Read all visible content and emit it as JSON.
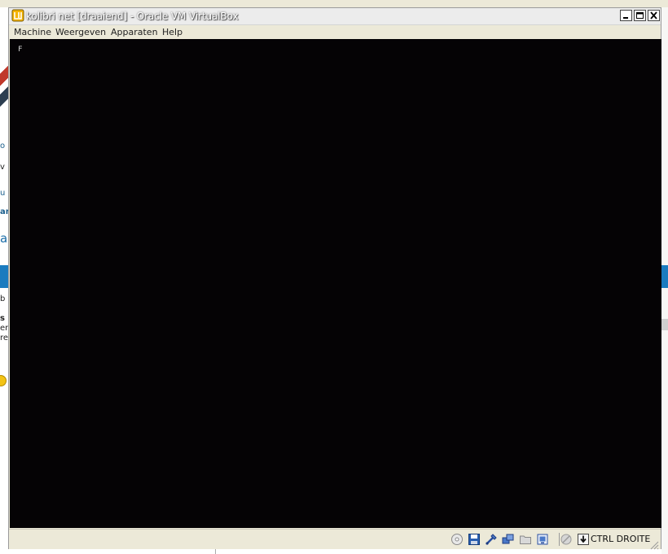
{
  "window": {
    "title": "kolibri net [draaiend] - Oracle VM VirtualBox"
  },
  "menu": {
    "items": [
      "Machine",
      "Weergeven",
      "Apparaten",
      "Help"
    ]
  },
  "screen": {
    "cursor_text": "F"
  },
  "statusbar": {
    "icons": [
      "optical-drive-icon",
      "floppy-disk-icon",
      "usb-icon",
      "network-icon",
      "shared-folders-icon",
      "display-icon",
      "mouse-integration-icon",
      "host-key-icon"
    ],
    "host_key_label": "CTRL DROITE"
  },
  "background_fragments": [
    "o",
    "v",
    "u",
    "ar",
    "a",
    "b",
    "s",
    "er",
    "re"
  ],
  "colors": {
    "screen_bg": "#050305",
    "chrome_bg": "#ece9d8",
    "accent_blue": "#1a7bbf"
  }
}
